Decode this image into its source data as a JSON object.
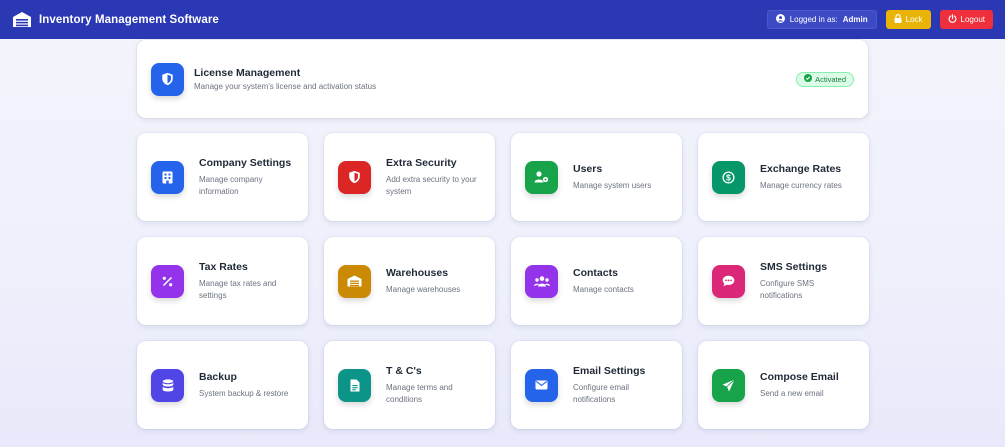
{
  "header": {
    "title": "Inventory Management Software",
    "logged_in_prefix": "Logged in as:",
    "user": "Admin",
    "lock_label": "Lock",
    "logout_label": "Logout",
    "bg_color": "#2b38b4"
  },
  "license": {
    "title": "License Management",
    "subtitle": "Manage your system's license and activation status",
    "status": "Activated",
    "icon": "shield-icon",
    "color": "#2563eb"
  },
  "cards": [
    {
      "title": "Company Settings",
      "subtitle": "Manage company information",
      "icon": "building-icon",
      "color": "#2563eb"
    },
    {
      "title": "Extra Security",
      "subtitle": "Add extra security to your system",
      "icon": "shield-icon",
      "color": "#dc2626"
    },
    {
      "title": "Users",
      "subtitle": "Manage system users",
      "icon": "user-gear-icon",
      "color": "#16a34a"
    },
    {
      "title": "Exchange Rates",
      "subtitle": "Manage currency rates",
      "icon": "dollar-icon",
      "color": "#059669"
    },
    {
      "title": "Tax Rates",
      "subtitle": "Manage tax rates and settings",
      "icon": "percent-icon",
      "color": "#9333ea"
    },
    {
      "title": "Warehouses",
      "subtitle": "Manage warehouses",
      "icon": "warehouse-icon",
      "color": "#ca8a04"
    },
    {
      "title": "Contacts",
      "subtitle": "Manage contacts",
      "icon": "users-icon",
      "color": "#9333ea"
    },
    {
      "title": "SMS Settings",
      "subtitle": "Configure SMS notifications",
      "icon": "chat-icon",
      "color": "#db2777"
    },
    {
      "title": "Backup",
      "subtitle": "System backup & restore",
      "icon": "database-icon",
      "color": "#4f46e5"
    },
    {
      "title": "T & C's",
      "subtitle": "Manage terms and conditions",
      "icon": "document-icon",
      "color": "#0d9488"
    },
    {
      "title": "Email Settings",
      "subtitle": "Configure email notifications",
      "icon": "envelope-icon",
      "color": "#2563eb"
    },
    {
      "title": "Compose Email",
      "subtitle": "Send a new email",
      "icon": "send-icon",
      "color": "#16a34a"
    }
  ]
}
